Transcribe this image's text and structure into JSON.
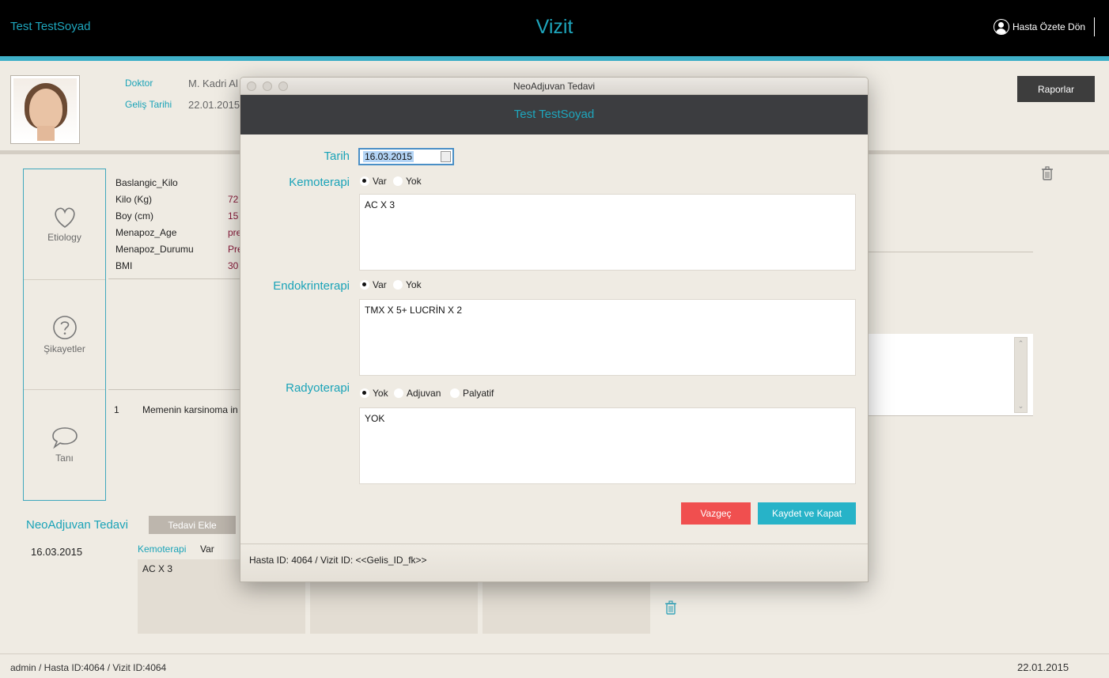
{
  "header": {
    "user_name": "Test TestSoyad",
    "title": "Vizit",
    "back_label": "Hasta Özete Dön"
  },
  "patient": {
    "doctor_label": "Doktor",
    "doctor_value": "M. Kadri Al",
    "arrival_label": "Geliş Tarihi",
    "arrival_value": "22.01.2015",
    "reports_label": "Raporlar"
  },
  "sidenav": {
    "items": [
      {
        "label": "Etiology",
        "icon": "heart-icon"
      },
      {
        "label": "Şikayetler",
        "icon": "question-icon"
      },
      {
        "label": "Tanı",
        "icon": "speech-bubble-icon"
      }
    ]
  },
  "vitals": {
    "rows": [
      {
        "label": "Baslangic_Kilo",
        "value": ""
      },
      {
        "label": "Kilo (Kg)",
        "value": "72"
      },
      {
        "label": "Boy (cm)",
        "value": "15"
      },
      {
        "label": "Menapoz_Age",
        "value": "pre"
      },
      {
        "label": "Menapoz_Durumu",
        "value": "Pre"
      },
      {
        "label": "BMI",
        "value": "30"
      }
    ]
  },
  "diagnosis": {
    "no": "1",
    "text": "Memenin karsinoma in"
  },
  "neoadjuvan": {
    "title": "NeoAdjuvan Tedavi",
    "add_label": "Tedavi Ekle",
    "date": "16.03.2015",
    "kemo_label": "Kemoterapi",
    "kemo_value": "Var",
    "kemo_text": "AC X 3"
  },
  "footer": {
    "left": "admin / Hasta ID:4064 / Vizit ID:4064",
    "right": "22.01.2015"
  },
  "dialog": {
    "window_title": "NeoAdjuvan Tedavi",
    "patient_name": "Test TestSoyad",
    "tarih_label": "Tarih",
    "tarih_value": "16.03.2015",
    "kemo_label": "Kemoterapi",
    "kemo_options": [
      "Var",
      "Yok"
    ],
    "kemo_selected": "Var",
    "kemo_text": "AC X 3",
    "endo_label": "Endokrinterapi",
    "endo_options": [
      "Var",
      "Yok"
    ],
    "endo_selected": "Var",
    "endo_text": "TMX X 5+ LUCRİN X 2",
    "radyo_label": "Radyoterapi",
    "radyo_options": [
      "Yok",
      "Adjuvan",
      "Palyatif"
    ],
    "radyo_selected": "Yok",
    "radyo_text": "YOK",
    "cancel_label": "Vazgeç",
    "save_label": "Kaydet ve Kapat",
    "footer_text": "Hasta ID: 4064 / Vizit ID: <<Gelis_ID_fk>>"
  },
  "colors": {
    "accent": "#1aa3b8",
    "cancel": "#f04f4f",
    "save": "#27b3c8",
    "header_bg": "#000000"
  }
}
